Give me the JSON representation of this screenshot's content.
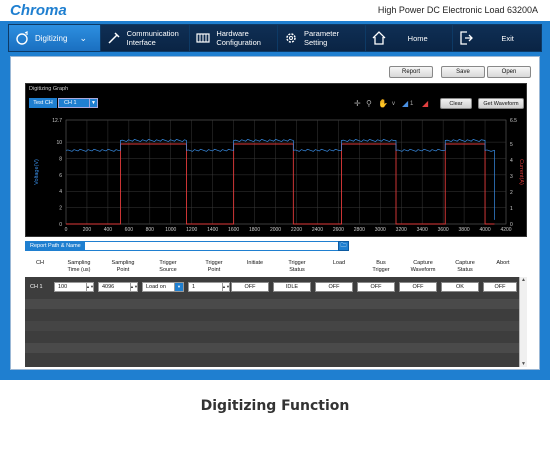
{
  "header": {
    "logo": "Chroma",
    "title": "High Power DC Electronic Load 63200A"
  },
  "nav": [
    {
      "label": "Digitizing",
      "icon": "digitizing-icon"
    },
    {
      "label": "Communication\nInterface",
      "icon": "plug-icon"
    },
    {
      "label": "Hardware\nConfiguration",
      "icon": "hardware-icon"
    },
    {
      "label": "Parameter\nSetting",
      "icon": "gear-icon"
    },
    {
      "label": "Home",
      "icon": "home-icon"
    },
    {
      "label": "Exit",
      "icon": "exit-icon"
    }
  ],
  "toolbar": {
    "report": "Report",
    "save": "Save",
    "open": "Open"
  },
  "graph": {
    "title": "Digitizing Graph",
    "test_ch": "Test CH",
    "channel": "CH 1",
    "clear": "Clear",
    "get_waveform": "Get Waveform",
    "cursor_label": "1",
    "colors": {
      "voltage": "#3a8fe8",
      "current": "#e03a3a"
    }
  },
  "chart_data": {
    "type": "line",
    "xlabel": "",
    "ylabel": "Voltage(V)",
    "y2label": "Current(A)",
    "xlim": [
      0,
      4200
    ],
    "ylim": [
      0,
      12.7
    ],
    "y2lim": [
      0,
      6.5
    ],
    "x_ticks": [
      0,
      200,
      400,
      600,
      800,
      1000,
      1200,
      1400,
      1600,
      1800,
      2000,
      2200,
      2400,
      2600,
      2800,
      3000,
      3200,
      3400,
      3600,
      3800,
      4000,
      4200
    ],
    "y_ticks": [
      "12.7",
      "10",
      "8",
      "6",
      "4",
      "2",
      "0"
    ],
    "y2_ticks": [
      "6.5",
      "5",
      "4",
      "3",
      "2",
      "1",
      "0"
    ],
    "series": [
      {
        "name": "Voltage",
        "x": [
          0,
          520,
          520,
          1150,
          1150,
          1600,
          1600,
          2170,
          2170,
          2630,
          2630,
          3150,
          3150,
          3620,
          3620,
          4000,
          4000,
          4090,
          4090
        ],
        "y": [
          9.0,
          9.0,
          10.2,
          10.2,
          9.0,
          9.0,
          10.2,
          10.2,
          9.0,
          9.0,
          10.2,
          10.2,
          9.0,
          9.0,
          10.2,
          10.2,
          9.0,
          9.0,
          0.5
        ]
      },
      {
        "name": "Current",
        "x": [
          0,
          520,
          520,
          1150,
          1150,
          1600,
          1600,
          2170,
          2170,
          2630,
          2630,
          3150,
          3150,
          3620,
          3620,
          4000,
          4000,
          4090,
          4090
        ],
        "y": [
          0,
          0,
          5.0,
          5.0,
          0,
          0,
          5.0,
          5.0,
          0,
          0,
          5.0,
          5.0,
          0,
          0,
          5.0,
          5.0,
          0,
          0,
          0
        ]
      }
    ]
  },
  "report": {
    "label": "Report Path & Name"
  },
  "columns": [
    "CH",
    "Sampling\nTime (us)",
    "Sampling\nPoint",
    "Trigger\nSource",
    "Trigger\nPoint",
    "Initiate",
    "Trigger\nStatus",
    "Load",
    "Bus\nTrigger",
    "Capture\nWaveform",
    "Capture\nStatus",
    "Abort"
  ],
  "row": {
    "ch": "CH 1",
    "sampling_time": "100",
    "sampling_point": "4096",
    "trigger_source": "Load on",
    "trigger_point": "1",
    "initiate": "OFF",
    "trigger_status": "IDLE",
    "load": "OFF",
    "bus_trigger": "OFF",
    "capture_waveform": "OFF",
    "capture_status": "OK",
    "abort": "OFF"
  },
  "caption": "Digitizing Function"
}
